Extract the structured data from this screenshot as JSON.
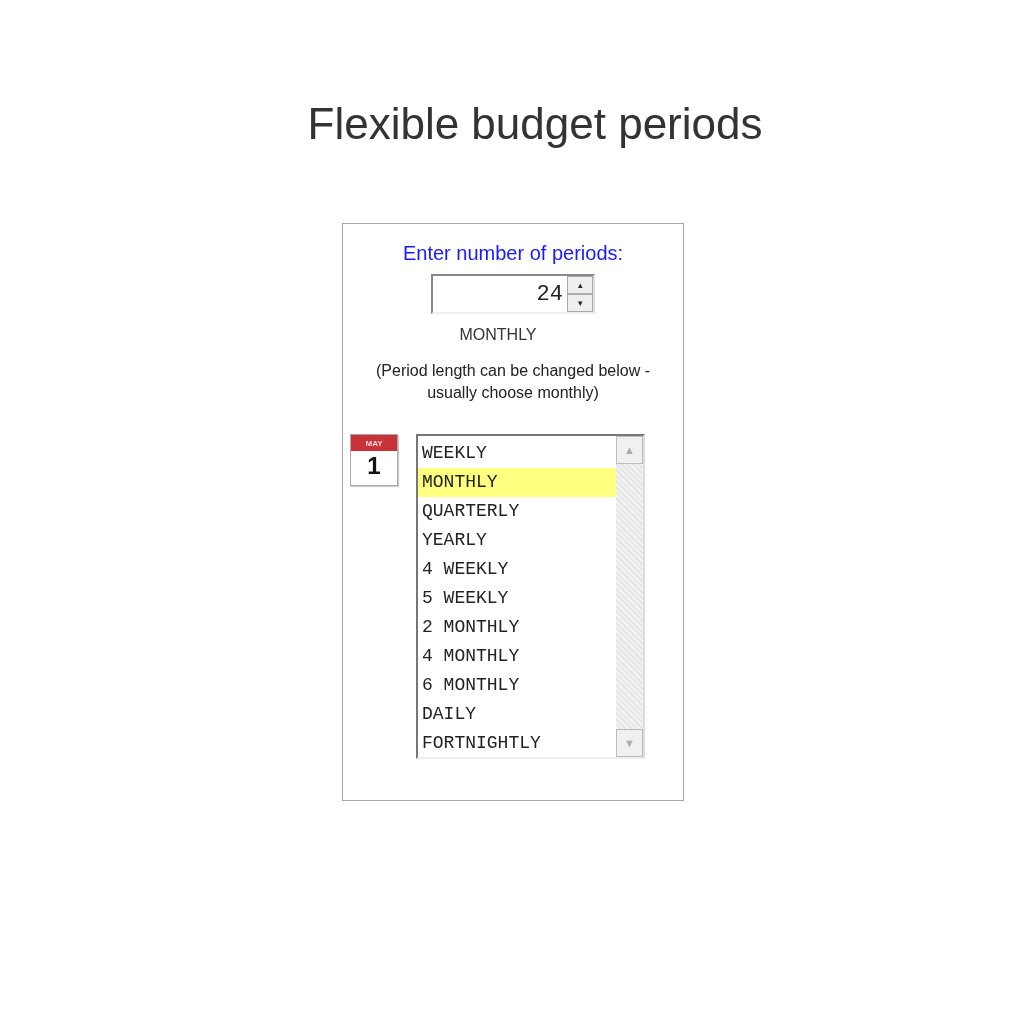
{
  "title": "Flexible budget periods",
  "panel": {
    "prompt": "Enter number of periods:",
    "periods": {
      "value": "24",
      "up": "▴",
      "down": "▾"
    },
    "current_period": "MONTHLY",
    "note": "(Period length can be changed below - usually choose monthly)",
    "calendar": {
      "month": "MAY",
      "day": "1"
    },
    "period_list": [
      {
        "label": "WEEKLY",
        "selected": false
      },
      {
        "label": "MONTHLY",
        "selected": true
      },
      {
        "label": "QUARTERLY",
        "selected": false
      },
      {
        "label": "YEARLY",
        "selected": false
      },
      {
        "label": "4 WEEKLY",
        "selected": false
      },
      {
        "label": "5 WEEKLY",
        "selected": false
      },
      {
        "label": "2 MONTHLY",
        "selected": false
      },
      {
        "label": "4 MONTHLY",
        "selected": false
      },
      {
        "label": "6 MONTHLY",
        "selected": false
      },
      {
        "label": "DAILY",
        "selected": false
      },
      {
        "label": "FORTNIGHTLY",
        "selected": false
      }
    ],
    "scroll_up": "▲",
    "scroll_down": "▼"
  }
}
